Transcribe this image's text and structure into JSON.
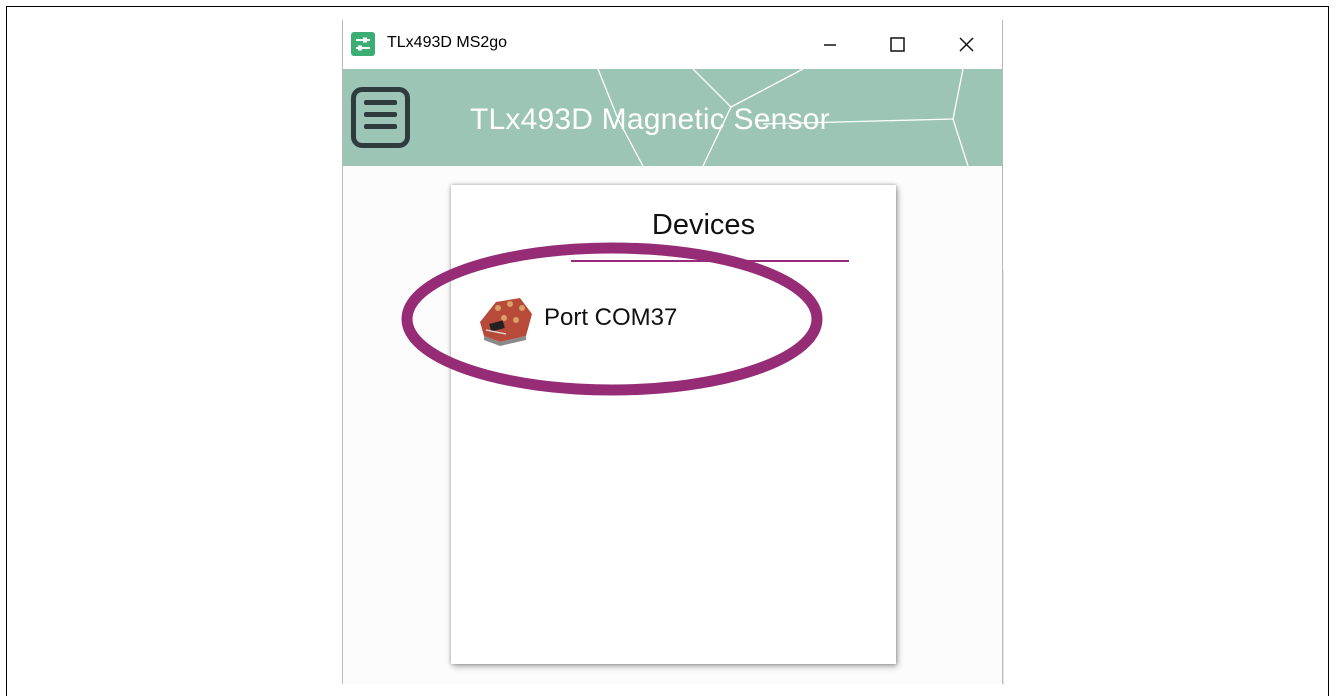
{
  "window": {
    "title": "TLx493D MS2go",
    "icon": "sliders-icon",
    "controls": [
      "minimize-icon",
      "maximize-icon",
      "close-icon"
    ]
  },
  "header": {
    "title": "TLx493D Magnetic Sensor",
    "menu_icon": "hamburger-menu-icon",
    "background": "#9cc5b6"
  },
  "devices": {
    "title": "Devices",
    "accent": "#9a2a78",
    "items": [
      {
        "label": "Port COM37",
        "icon": "sensor-board-icon"
      }
    ]
  },
  "annotation": {
    "color": "#962c76",
    "shape": "ellipse"
  }
}
